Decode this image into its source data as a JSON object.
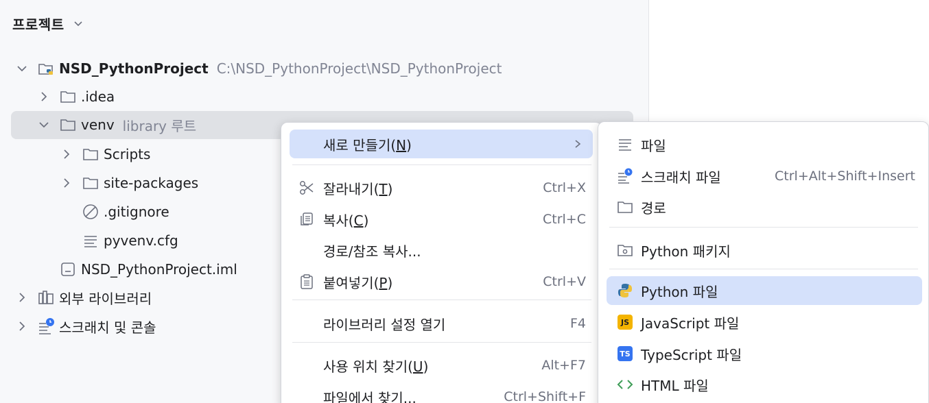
{
  "panel": {
    "title": "프로젝트"
  },
  "tree": {
    "root": {
      "name": "NSD_PythonProject",
      "path": "C:\\NSD_PythonProject\\NSD_PythonProject"
    },
    "idea": {
      "name": ".idea"
    },
    "venv": {
      "name": "venv",
      "hint": "library 루트"
    },
    "scripts": {
      "name": "Scripts"
    },
    "site_packages": {
      "name": "site-packages"
    },
    "gitignore": {
      "name": ".gitignore"
    },
    "pyvenv": {
      "name": "pyvenv.cfg"
    },
    "iml": {
      "name": "NSD_PythonProject.iml"
    },
    "external_libs": {
      "name": "외부 라이브러리"
    },
    "scratches": {
      "name": "스크래치 및 콘솔"
    }
  },
  "context_menu": {
    "new": {
      "label": "새로 만들기(",
      "mnemonic": "N",
      "suffix": ")"
    },
    "cut": {
      "label": "잘라내기(",
      "mnemonic": "T",
      "suffix": ")",
      "shortcut": "Ctrl+X"
    },
    "copy": {
      "label": "복사(",
      "mnemonic": "C",
      "suffix": ")",
      "shortcut": "Ctrl+C"
    },
    "copy_path": {
      "label": "경로/참조 복사..."
    },
    "paste": {
      "label": "붙여넣기(",
      "mnemonic": "P",
      "suffix": ")",
      "shortcut": "Ctrl+V"
    },
    "library_settings": {
      "label": "라이브러리 설정 열기",
      "shortcut": "F4"
    },
    "find_usages": {
      "label": "사용 위치 찾기(",
      "mnemonic": "U",
      "suffix": ")",
      "shortcut": "Alt+F7"
    },
    "find_in_files": {
      "label": "파일에서 찾기...",
      "shortcut": "Ctrl+Shift+F"
    }
  },
  "submenu": {
    "file": {
      "label": "파일"
    },
    "scratch": {
      "label": "스크래치 파일",
      "shortcut": "Ctrl+Alt+Shift+Insert"
    },
    "directory": {
      "label": "경로"
    },
    "python_package": {
      "label": "Python 패키지"
    },
    "python_file": {
      "label": "Python 파일"
    },
    "javascript_file": {
      "label": "JavaScript 파일",
      "badge": "JS"
    },
    "typescript_file": {
      "label": "TypeScript 파일",
      "badge": "TS"
    },
    "html_file": {
      "label": "HTML 파일"
    }
  },
  "colors": {
    "highlight": "#d5e1fb",
    "selection": "#dfe1e5",
    "js_badge": "#f4b400",
    "ts_badge": "#3574f0",
    "html_icon": "#3f9d58",
    "python_blue": "#3572a5",
    "python_yellow": "#f0c33c"
  }
}
